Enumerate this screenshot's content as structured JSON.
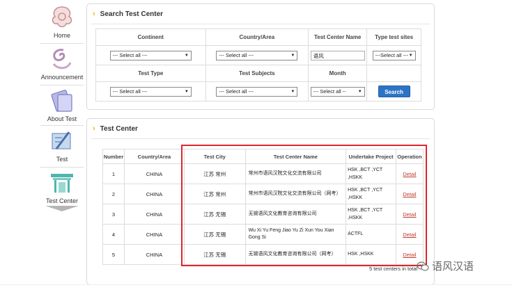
{
  "sidebar": {
    "items": [
      {
        "label": "Home",
        "icon": "home-icon"
      },
      {
        "label": "Announcement",
        "icon": "announcement-icon"
      },
      {
        "label": "About Test",
        "icon": "about-test-icon"
      },
      {
        "label": "Test",
        "icon": "test-icon"
      },
      {
        "label": "Test Center",
        "icon": "test-center-icon"
      }
    ]
  },
  "search": {
    "title": "Search Test Center",
    "headers_row1": [
      "Continent",
      "Country/Area",
      "Test Center Name",
      "Type test sites"
    ],
    "headers_row2": [
      "Test Type",
      "Test Subjects",
      "Month"
    ],
    "continent_value": "--- Select all ---",
    "country_value": "--- Select all ---",
    "center_name_value": "语风",
    "type_sites_value": "---Select all ---",
    "test_type_value": "--- Select all ---",
    "subjects_value": "--- Select all ---",
    "month_value": "--- Select all --",
    "search_button": "Search"
  },
  "results": {
    "title": "Test Center",
    "columns": [
      "Number",
      "Country/Area",
      "Test City",
      "Test Center Name",
      "Undertake Project",
      "Operation"
    ],
    "rows": [
      {
        "number": "1",
        "country": "CHINA",
        "city": "江苏 常州",
        "name": "常州市语风汉院文化交流有限公司",
        "project_line1": "HSK ,BCT ,YCT",
        "project_line2": ",HSKK",
        "op": "Detail"
      },
      {
        "number": "2",
        "country": "CHINA",
        "city": "江苏 常州",
        "name": "常州市语风汉院文化交流有限公司（网考）",
        "project_line1": "HSK ,BCT ,YCT",
        "project_line2": ",HSKK",
        "op": "Detail"
      },
      {
        "number": "3",
        "country": "CHINA",
        "city": "江苏 无锡",
        "name": "无锡语风文化教育咨询有限公司",
        "project_line1": "HSK ,BCT ,YCT",
        "project_line2": ",HSKK",
        "op": "Detail"
      },
      {
        "number": "4",
        "country": "CHINA",
        "city": "江苏 无锡",
        "name": "Wu Xi Yu Feng Jiao Yu Zi Xun You Xian Gong Si",
        "project_line1": "ACTFL",
        "project_line2": "",
        "op": "Detail"
      },
      {
        "number": "5",
        "country": "CHINA",
        "city": "江苏 无锡",
        "name": "无锡语风文化教育咨询有限公司（网考）",
        "project_line1": "HSK ,HSKK",
        "project_line2": "",
        "op": "Detail"
      }
    ],
    "total": "5 test centers in total"
  },
  "brand": {
    "text": "语风汉语",
    "icon": "wechat-icon"
  },
  "colors": {
    "accent_chevron": "#f0b400",
    "button": "#2e74c6",
    "highlight": "#e0242b",
    "link": "#c0392b"
  }
}
